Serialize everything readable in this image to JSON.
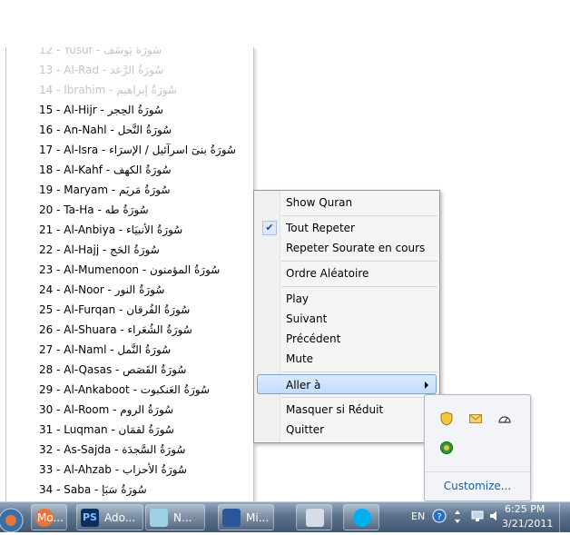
{
  "surah_menu": {
    "items": [
      {
        "label": "12 - Yusuf - سُورَةُ يُوسُف",
        "faded": true
      },
      {
        "label": "13 - Al-Rad - سُورَةُ الرَّعد",
        "faded": true
      },
      {
        "label": "14 - Ibrahim - سُورَةُ إبراهيم",
        "faded": true
      },
      {
        "label": "15 - Al-Hijr - سُورَةُ الحِجر",
        "faded": false
      },
      {
        "label": "16 - An-Nahl - سُورَةُ النَّحل",
        "faded": false
      },
      {
        "label": "17 - Al-Isra - سُورَةُ بنىٓ اسرآئيل / الإسرَاء",
        "faded": false
      },
      {
        "label": "18 - Al-Kahf - سُورَةُ الكهف",
        "faded": false
      },
      {
        "label": "19 - Maryam - سُورَةُ مَريَم",
        "faded": false
      },
      {
        "label": "20 - Ta-Ha - سُورَةُ طه",
        "faded": false
      },
      {
        "label": "21 - Al-Anbiya - سُورَةُ الأنبيَاء",
        "faded": false
      },
      {
        "label": "22 - Al-Hajj - سُورَةُ الحَج",
        "faded": false
      },
      {
        "label": "23 - Al-Mumenoon - سُورَةُ المؤمنون",
        "faded": false
      },
      {
        "label": "24 - Al-Noor - سُورَةُ النور",
        "faded": false
      },
      {
        "label": "25 - Al-Furqan - سُورَةُ الفُرقان",
        "faded": false
      },
      {
        "label": "26 - Al-Shuara - سُورَةُ الشُعَراء",
        "faded": false
      },
      {
        "label": "27 - Al-Naml - سُورَةُ النَّمل",
        "faded": false
      },
      {
        "label": "28 - Al-Qasas - سُورَةُ القَصَص",
        "faded": false
      },
      {
        "label": "29 - Al-Ankaboot - سُورَةُ العَنكبوت",
        "faded": false
      },
      {
        "label": "30 - Al-Room - سُورَةُ الروم",
        "faded": false
      },
      {
        "label": "31 - Luqman - سُورَةُ لقمَان",
        "faded": false
      },
      {
        "label": "32 - As-Sajda - سُورَةُ السَّجدَة",
        "faded": false
      },
      {
        "label": "33 - Al-Ahzab - سُورَةُ الأحزاب",
        "faded": false
      },
      {
        "label": "34 - Saba - سُورَةُ سَبَإ",
        "faded": false
      }
    ]
  },
  "context_menu": {
    "show_quran": "Show Quran",
    "tout_repeter": "Tout Repeter",
    "tout_repeter_checked": true,
    "repeter_sourate": "Repeter Sourate en cours",
    "ordre_aleatoire": "Ordre Aléatoire",
    "play": "Play",
    "suivant": "Suivant",
    "precedent": "Précédent",
    "mute": "Mute",
    "aller_a": "Aller à",
    "masquer": "Masquer si Réduit",
    "quitter": "Quitter",
    "check_glyph": "✔"
  },
  "tray_overflow": {
    "customize": "Customize..."
  },
  "taskbar": {
    "buttons": [
      {
        "label": "Mo..."
      },
      {
        "label": "Ado..."
      },
      {
        "label": "N..."
      },
      {
        "label": "Mi..."
      }
    ],
    "language": "EN",
    "time": "6:25 PM",
    "date": "3/21/2011"
  },
  "colors": {
    "accent": "#7da2ce",
    "taskbar": "#5f7690",
    "link": "#1f5a9e"
  }
}
